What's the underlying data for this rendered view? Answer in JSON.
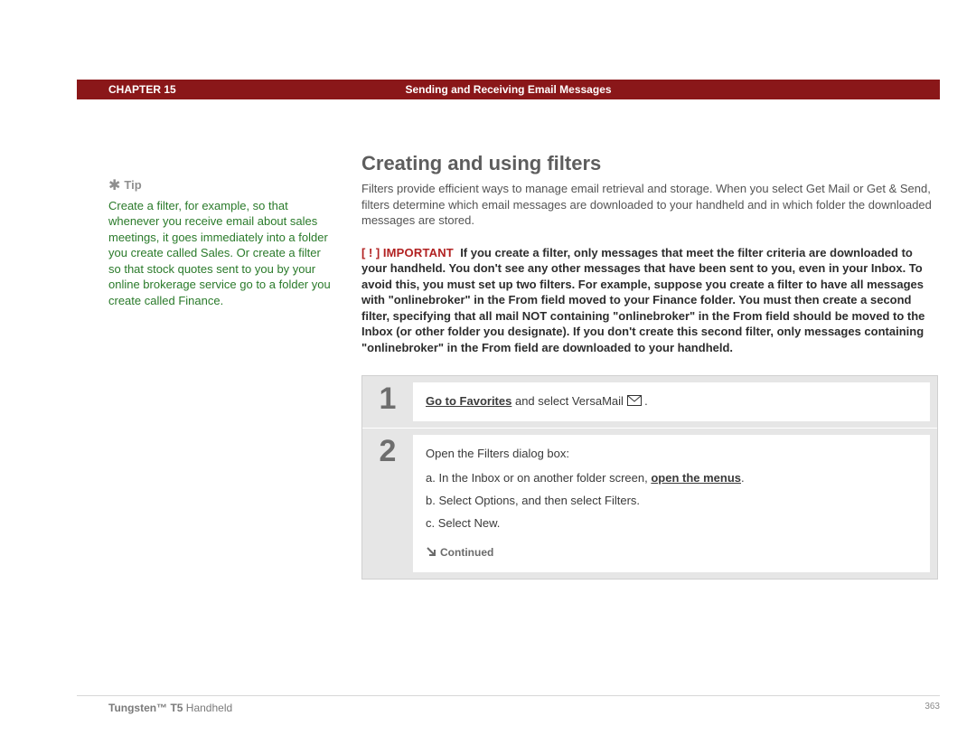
{
  "header": {
    "chapter": "CHAPTER 15",
    "title": "Sending and Receiving Email Messages"
  },
  "tip": {
    "label": "Tip",
    "text": "Create a filter, for example, so that whenever you receive email about sales meetings, it goes immediately into a folder you create called Sales. Or create a filter so that stock quotes sent to you by your online brokerage service go to a folder you create called Finance."
  },
  "section": {
    "title": "Creating and using filters",
    "intro": "Filters provide efficient ways to manage email retrieval and storage. When you select Get Mail or Get & Send, filters determine which email messages are downloaded to your handheld and in which folder the downloaded messages are stored."
  },
  "important": {
    "badge": "[ ! ]",
    "label": "IMPORTANT",
    "text": "If you create a filter, only messages that meet the filter criteria are downloaded to your handheld. You don't see any other messages that have been sent to you, even in your Inbox. To avoid this, you must set up two filters. For example, suppose you create a filter to have all messages with \"onlinebroker\" in the From field moved to your Finance folder. You must then create a second filter, specifying that all mail NOT containing \"onlinebroker\" in the From field should be moved to the Inbox (or other folder you designate). If you don't create this second filter, only messages containing \"onlinebroker\" in the From field are downloaded to your handheld."
  },
  "steps": {
    "one": {
      "num": "1",
      "link": "Go to Favorites",
      "tail": " and select VersaMail "
    },
    "two": {
      "num": "2",
      "lead": "Open the Filters dialog box:",
      "a_pre": "a.  In the Inbox or on another folder screen, ",
      "a_link": "open the menus",
      "a_post": ".",
      "b": "b.  Select Options, and then select Filters.",
      "c": "c.  Select New."
    },
    "continued": "Continued"
  },
  "footer": {
    "brand": "Tungsten™ T5",
    "product": " Handheld",
    "page": "363"
  }
}
